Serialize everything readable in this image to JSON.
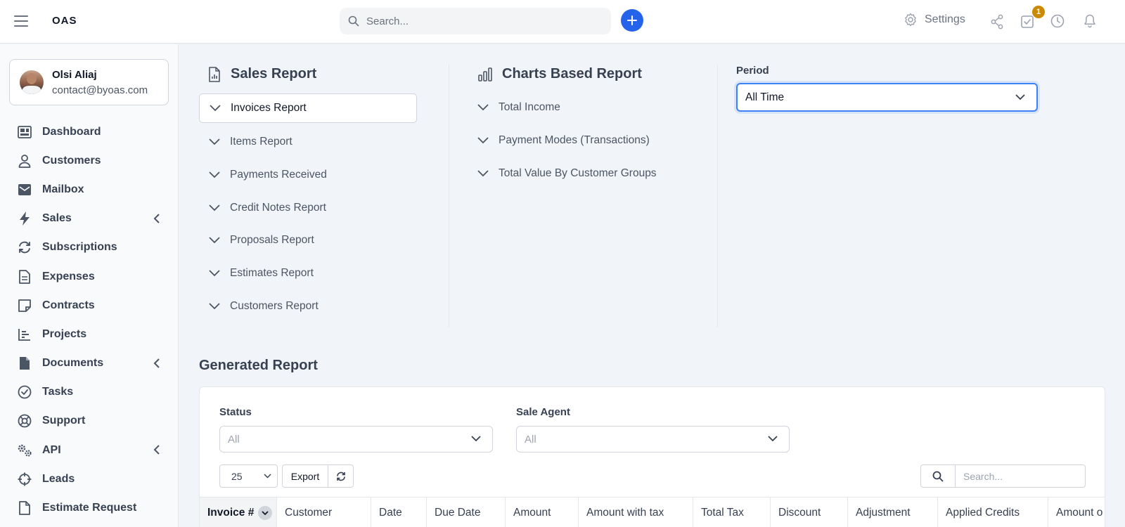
{
  "topbar": {
    "logo": "OAS",
    "search_placeholder": "Search...",
    "settings_label": "Settings",
    "tasks_badge": "1"
  },
  "profile": {
    "name": "Olsi Aliaj",
    "email": "contact@byoas.com"
  },
  "sidebar": {
    "items": [
      {
        "label": "Dashboard",
        "icon": "dashboard-icon"
      },
      {
        "label": "Customers",
        "icon": "user-icon"
      },
      {
        "label": "Mailbox",
        "icon": "envelope-icon"
      },
      {
        "label": "Sales",
        "icon": "bolt-icon",
        "expandable": true
      },
      {
        "label": "Subscriptions",
        "icon": "repeat-icon"
      },
      {
        "label": "Expenses",
        "icon": "file-icon"
      },
      {
        "label": "Contracts",
        "icon": "sticky-note-icon"
      },
      {
        "label": "Projects",
        "icon": "chart-bars-icon"
      },
      {
        "label": "Documents",
        "icon": "document-icon",
        "expandable": true
      },
      {
        "label": "Tasks",
        "icon": "check-circle-icon"
      },
      {
        "label": "Support",
        "icon": "life-ring-icon"
      },
      {
        "label": "API",
        "icon": "cogs-icon",
        "expandable": true
      },
      {
        "label": "Leads",
        "icon": "crosshair-icon"
      },
      {
        "label": "Estimate Request",
        "icon": "file-outline-icon"
      }
    ]
  },
  "sales_report": {
    "title": "Sales Report",
    "items": [
      "Invoices Report",
      "Items Report",
      "Payments Received",
      "Credit Notes Report",
      "Proposals Report",
      "Estimates Report",
      "Customers Report"
    ],
    "active_index": 0
  },
  "charts_report": {
    "title": "Charts Based Report",
    "items": [
      "Total Income",
      "Payment Modes (Transactions)",
      "Total Value By Customer Groups"
    ]
  },
  "period": {
    "label": "Period",
    "selected": "All Time"
  },
  "generated": {
    "title": "Generated Report",
    "status_label": "Status",
    "status_value": "All",
    "agent_label": "Sale Agent",
    "agent_value": "All",
    "page_size": "25",
    "export_label": "Export",
    "search_placeholder": "Search...",
    "columns": [
      "Invoice #",
      "Customer",
      "Date",
      "Due Date",
      "Amount",
      "Amount with tax",
      "Total Tax",
      "Discount",
      "Adjustment",
      "Applied Credits",
      "Amount o"
    ]
  },
  "colors": {
    "accent": "#2563eb",
    "badge": "#ca8a04",
    "focus_border": "#3b82f6"
  }
}
